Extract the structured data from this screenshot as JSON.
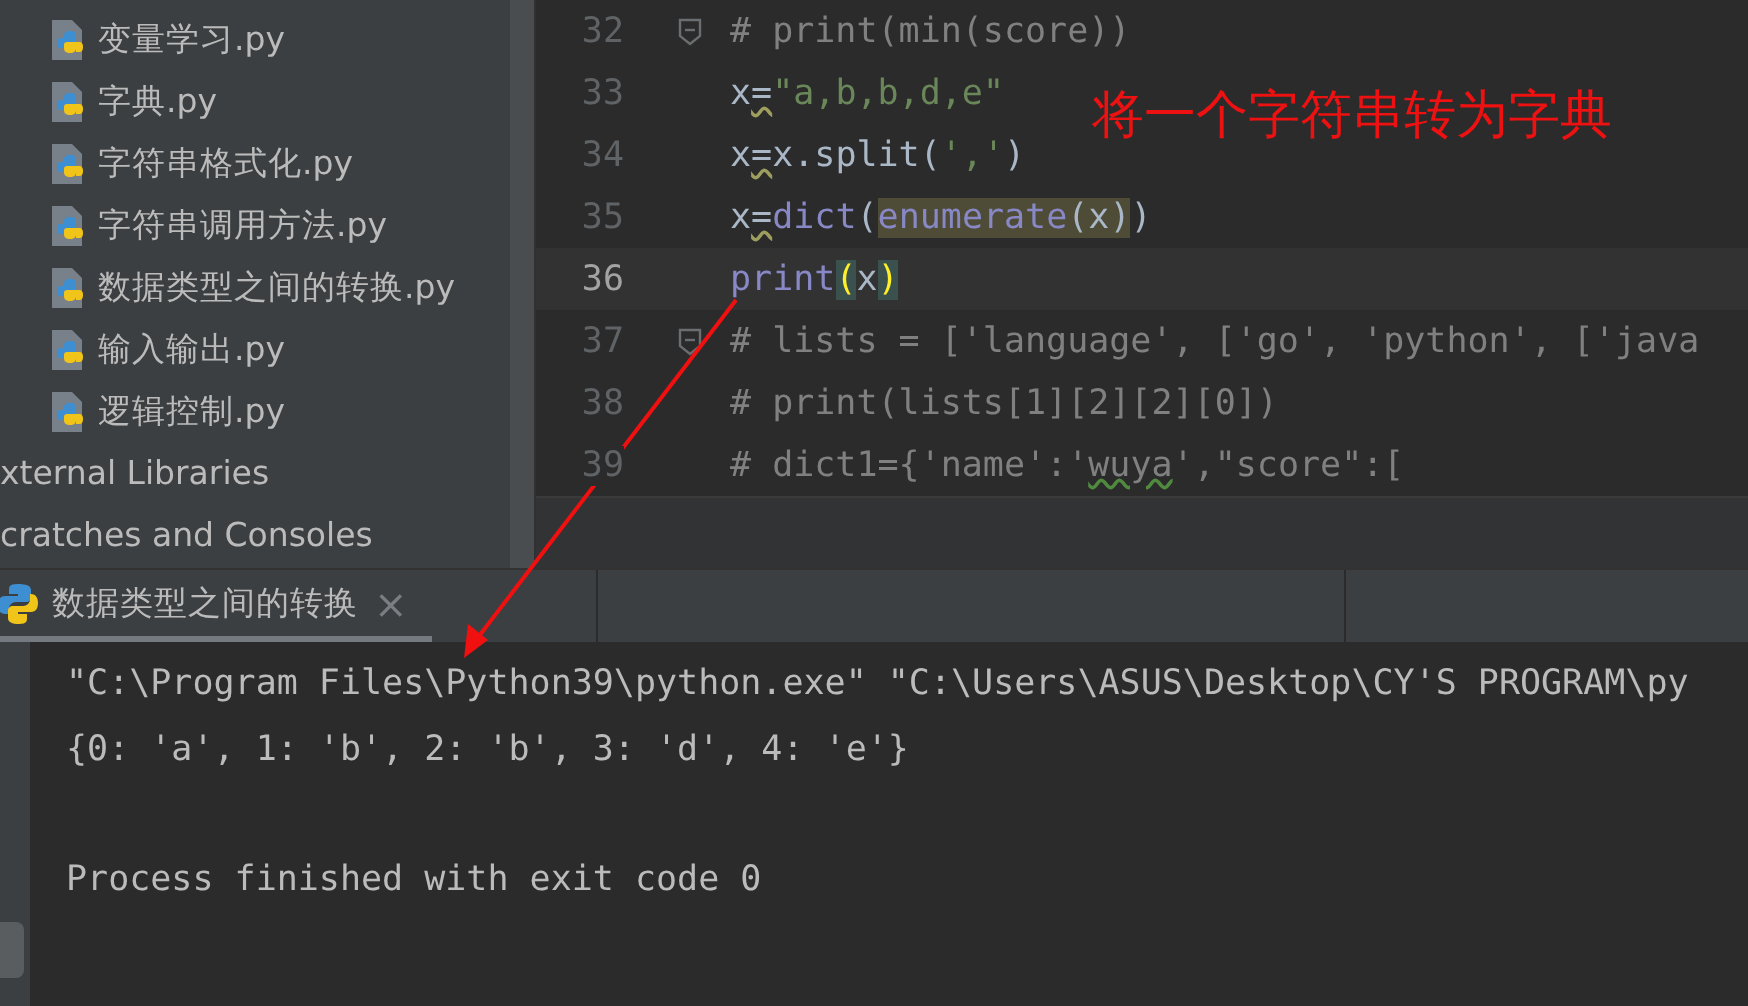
{
  "project_tree": {
    "items": [
      {
        "kind": "file",
        "label": "变量学习.py"
      },
      {
        "kind": "file",
        "label": "字典.py"
      },
      {
        "kind": "file",
        "label": "字符串格式化.py"
      },
      {
        "kind": "file",
        "label": "字符串调用方法.py"
      },
      {
        "kind": "file",
        "label": "数据类型之间的转换.py"
      },
      {
        "kind": "file",
        "label": "输入输出.py"
      },
      {
        "kind": "file",
        "label": "逻辑控制.py"
      },
      {
        "kind": "group",
        "label": "xternal Libraries"
      },
      {
        "kind": "group",
        "label": "cratches and Consoles"
      }
    ]
  },
  "editor": {
    "lines": [
      {
        "number": "32",
        "current": false,
        "fold": true,
        "tokens": [
          {
            "kind": "comment",
            "text": "# print(min(score))"
          }
        ]
      },
      {
        "number": "33",
        "current": false,
        "fold": false,
        "tokens": [
          {
            "kind": "plain",
            "text": "x"
          },
          {
            "kind": "warn",
            "text": "="
          },
          {
            "kind": "string",
            "text": "\"a,b,b,d,e\""
          }
        ]
      },
      {
        "number": "34",
        "current": false,
        "fold": false,
        "tokens": [
          {
            "kind": "plain",
            "text": "x"
          },
          {
            "kind": "warn",
            "text": "="
          },
          {
            "kind": "plain",
            "text": "x.split("
          },
          {
            "kind": "string",
            "text": "','"
          },
          {
            "kind": "plain",
            "text": ")"
          }
        ]
      },
      {
        "number": "35",
        "current": false,
        "fold": false,
        "tokens": [
          {
            "kind": "plain",
            "text": "x"
          },
          {
            "kind": "warn",
            "text": "="
          },
          {
            "kind": "builtin",
            "text": "dict"
          },
          {
            "kind": "plain",
            "text": "("
          },
          {
            "kind": "marked-builtin",
            "text": "enumerate"
          },
          {
            "kind": "marked-plain",
            "text": "(x)"
          },
          {
            "kind": "plain",
            "text": ")"
          }
        ]
      },
      {
        "number": "36",
        "current": true,
        "fold": false,
        "tokens": [
          {
            "kind": "builtin",
            "text": "print"
          },
          {
            "kind": "brace",
            "text": "("
          },
          {
            "kind": "plain",
            "text": "x"
          },
          {
            "kind": "brace",
            "text": ")"
          }
        ]
      },
      {
        "number": "37",
        "current": false,
        "fold": true,
        "tokens": [
          {
            "kind": "comment",
            "text": "# lists = ['language', ['go', 'python', ['java"
          }
        ]
      },
      {
        "number": "38",
        "current": false,
        "fold": false,
        "tokens": [
          {
            "kind": "comment",
            "text": "# print(lists[1][2][2][0])"
          }
        ]
      },
      {
        "number": "39",
        "current": false,
        "fold": false,
        "tokens": [
          {
            "kind": "comment",
            "text": "# dict1={'name':'"
          },
          {
            "kind": "comment-typo",
            "text": "wuya"
          },
          {
            "kind": "comment",
            "text": "',\"score\":["
          }
        ]
      }
    ]
  },
  "annotation": {
    "text": "将一个字符串转为字典"
  },
  "run_panel": {
    "tab": {
      "label": "数据类型之间的转换",
      "close": "×"
    },
    "output": [
      {
        "text": "\"C:\\Program Files\\Python39\\python.exe\" \"C:\\Users\\ASUS\\Desktop\\CY'S PROGRAM\\py",
        "gap_before": false
      },
      {
        "text": "{0: 'a', 1: 'b', 2: 'b', 3: 'd', 4: 'e'}",
        "gap_before": false
      },
      {
        "text": "Process finished with exit code 0",
        "gap_before": true
      }
    ]
  }
}
